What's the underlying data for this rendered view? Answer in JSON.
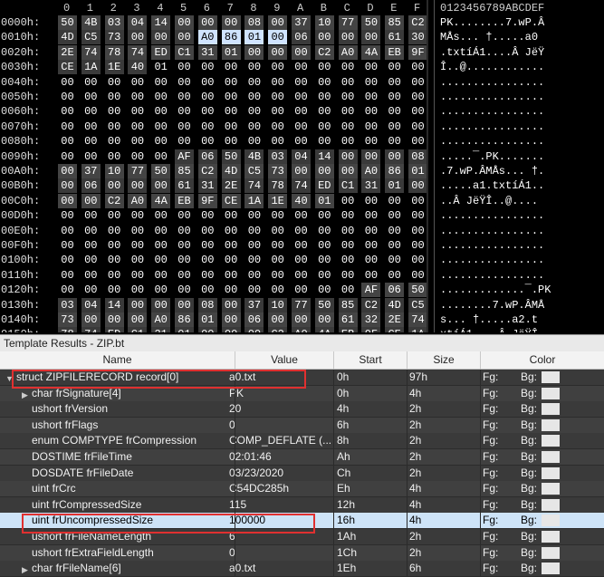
{
  "hex_header": {
    "columns": [
      "0",
      "1",
      "2",
      "3",
      "4",
      "5",
      "6",
      "7",
      "8",
      "9",
      "A",
      "B",
      "C",
      "D",
      "E",
      "F"
    ],
    "ascii_header": "0123456789ABCDEF"
  },
  "hex_rows": [
    {
      "offset": "0000h:",
      "bytes": [
        "50",
        "4B",
        "03",
        "04",
        "14",
        "00",
        "00",
        "00",
        "08",
        "00",
        "37",
        "10",
        "77",
        "50",
        "85",
        "C2"
      ],
      "ascii": "PK........7.wP.Â"
    },
    {
      "offset": "0010h:",
      "bytes": [
        "4D",
        "C5",
        "73",
        "00",
        "00",
        "00",
        "A0",
        "86",
        "01",
        "00",
        "06",
        "00",
        "00",
        "00",
        "61",
        "30"
      ],
      "ascii": "MÅs... †.....a0"
    },
    {
      "offset": "0020h:",
      "bytes": [
        "2E",
        "74",
        "78",
        "74",
        "ED",
        "C1",
        "31",
        "01",
        "00",
        "00",
        "00",
        "C2",
        "A0",
        "4A",
        "EB",
        "9F"
      ],
      "ascii": ".txtíÁ1....Â JëŸ"
    },
    {
      "offset": "0030h:",
      "bytes": [
        "CE",
        "1A",
        "1E",
        "40",
        "01",
        "00",
        "00",
        "00",
        "00",
        "00",
        "00",
        "00",
        "00",
        "00",
        "00",
        "00"
      ],
      "ascii": "Î..@............"
    },
    {
      "offset": "0040h:",
      "bytes": [
        "00",
        "00",
        "00",
        "00",
        "00",
        "00",
        "00",
        "00",
        "00",
        "00",
        "00",
        "00",
        "00",
        "00",
        "00",
        "00"
      ],
      "ascii": "................"
    },
    {
      "offset": "0050h:",
      "bytes": [
        "00",
        "00",
        "00",
        "00",
        "00",
        "00",
        "00",
        "00",
        "00",
        "00",
        "00",
        "00",
        "00",
        "00",
        "00",
        "00"
      ],
      "ascii": "................"
    },
    {
      "offset": "0060h:",
      "bytes": [
        "00",
        "00",
        "00",
        "00",
        "00",
        "00",
        "00",
        "00",
        "00",
        "00",
        "00",
        "00",
        "00",
        "00",
        "00",
        "00"
      ],
      "ascii": "................"
    },
    {
      "offset": "0070h:",
      "bytes": [
        "00",
        "00",
        "00",
        "00",
        "00",
        "00",
        "00",
        "00",
        "00",
        "00",
        "00",
        "00",
        "00",
        "00",
        "00",
        "00"
      ],
      "ascii": "................"
    },
    {
      "offset": "0080h:",
      "bytes": [
        "00",
        "00",
        "00",
        "00",
        "00",
        "00",
        "00",
        "00",
        "00",
        "00",
        "00",
        "00",
        "00",
        "00",
        "00",
        "00"
      ],
      "ascii": "................"
    },
    {
      "offset": "0090h:",
      "bytes": [
        "00",
        "00",
        "00",
        "00",
        "00",
        "AF",
        "06",
        "50",
        "4B",
        "03",
        "04",
        "14",
        "00",
        "00",
        "00",
        "08"
      ],
      "ascii": ".....¯.PK......."
    },
    {
      "offset": "00A0h:",
      "bytes": [
        "00",
        "37",
        "10",
        "77",
        "50",
        "85",
        "C2",
        "4D",
        "C5",
        "73",
        "00",
        "00",
        "00",
        "A0",
        "86",
        "01"
      ],
      "ascii": ".7.wP.ÂMÅs... †."
    },
    {
      "offset": "00B0h:",
      "bytes": [
        "00",
        "06",
        "00",
        "00",
        "00",
        "61",
        "31",
        "2E",
        "74",
        "78",
        "74",
        "ED",
        "C1",
        "31",
        "01",
        "00"
      ],
      "ascii": ".....a1.txtíÁ1.."
    },
    {
      "offset": "00C0h:",
      "bytes": [
        "00",
        "00",
        "C2",
        "A0",
        "4A",
        "EB",
        "9F",
        "CE",
        "1A",
        "1E",
        "40",
        "01",
        "00",
        "00",
        "00",
        "00"
      ],
      "ascii": "..Â JëŸÎ..@...."
    },
    {
      "offset": "00D0h:",
      "bytes": [
        "00",
        "00",
        "00",
        "00",
        "00",
        "00",
        "00",
        "00",
        "00",
        "00",
        "00",
        "00",
        "00",
        "00",
        "00",
        "00"
      ],
      "ascii": "................"
    },
    {
      "offset": "00E0h:",
      "bytes": [
        "00",
        "00",
        "00",
        "00",
        "00",
        "00",
        "00",
        "00",
        "00",
        "00",
        "00",
        "00",
        "00",
        "00",
        "00",
        "00"
      ],
      "ascii": "................"
    },
    {
      "offset": "00F0h:",
      "bytes": [
        "00",
        "00",
        "00",
        "00",
        "00",
        "00",
        "00",
        "00",
        "00",
        "00",
        "00",
        "00",
        "00",
        "00",
        "00",
        "00"
      ],
      "ascii": "................"
    },
    {
      "offset": "0100h:",
      "bytes": [
        "00",
        "00",
        "00",
        "00",
        "00",
        "00",
        "00",
        "00",
        "00",
        "00",
        "00",
        "00",
        "00",
        "00",
        "00",
        "00"
      ],
      "ascii": "................"
    },
    {
      "offset": "0110h:",
      "bytes": [
        "00",
        "00",
        "00",
        "00",
        "00",
        "00",
        "00",
        "00",
        "00",
        "00",
        "00",
        "00",
        "00",
        "00",
        "00",
        "00"
      ],
      "ascii": "................"
    },
    {
      "offset": "0120h:",
      "bytes": [
        "00",
        "00",
        "00",
        "00",
        "00",
        "00",
        "00",
        "00",
        "00",
        "00",
        "00",
        "00",
        "00",
        "AF",
        "06",
        "50",
        "4B"
      ],
      "ascii": ".............¯.PK"
    },
    {
      "offset": "0130h:",
      "bytes": [
        "03",
        "04",
        "14",
        "00",
        "00",
        "00",
        "08",
        "00",
        "37",
        "10",
        "77",
        "50",
        "85",
        "C2",
        "4D",
        "C5"
      ],
      "ascii": "........7.wP.ÂMÅ"
    },
    {
      "offset": "0140h:",
      "bytes": [
        "73",
        "00",
        "00",
        "00",
        "A0",
        "86",
        "01",
        "00",
        "06",
        "00",
        "00",
        "00",
        "61",
        "32",
        "2E",
        "74"
      ],
      "ascii": "s... †.....a2.t"
    },
    {
      "offset": "0150h:",
      "bytes": [
        "78",
        "74",
        "ED",
        "C1",
        "31",
        "01",
        "00",
        "00",
        "00",
        "C2",
        "A0",
        "4A",
        "EB",
        "9F",
        "CE",
        "1A"
      ],
      "ascii": "xtíÁ1....Â JëŸÎ."
    }
  ],
  "template": {
    "title": "Template Results - ZIP.bt",
    "headers": {
      "name": "Name",
      "value": "Value",
      "start": "Start",
      "size": "Size",
      "color": "Color"
    },
    "rows": [
      {
        "name": "struct ZIPFILERECORD record[0]",
        "value": "a0.txt",
        "start": "0h",
        "size": "97h",
        "fg": "Fg:",
        "bg": "Bg:"
      },
      {
        "name": "char frSignature[4]",
        "value": "PK",
        "start": "0h",
        "size": "4h",
        "fg": "Fg:",
        "bg": "Bg:"
      },
      {
        "name": "ushort frVersion",
        "value": "20",
        "start": "4h",
        "size": "2h",
        "fg": "Fg:",
        "bg": "Bg:"
      },
      {
        "name": "ushort frFlags",
        "value": "0",
        "start": "6h",
        "size": "2h",
        "fg": "Fg:",
        "bg": "Bg:"
      },
      {
        "name": "enum COMPTYPE frCompression",
        "value": "COMP_DEFLATE (...",
        "start": "8h",
        "size": "2h",
        "fg": "Fg:",
        "bg": "Bg:"
      },
      {
        "name": "DOSTIME frFileTime",
        "value": "02:01:46",
        "start": "Ah",
        "size": "2h",
        "fg": "Fg:",
        "bg": "Bg:"
      },
      {
        "name": "DOSDATE frFileDate",
        "value": "03/23/2020",
        "start": "Ch",
        "size": "2h",
        "fg": "Fg:",
        "bg": "Bg:"
      },
      {
        "name": "uint frCrc",
        "value": "C54DC285h",
        "start": "Eh",
        "size": "4h",
        "fg": "Fg:",
        "bg": "Bg:"
      },
      {
        "name": "uint frCompressedSize",
        "value": "115",
        "start": "12h",
        "size": "4h",
        "fg": "Fg:",
        "bg": "Bg:"
      },
      {
        "name": "uint frUncompressedSize",
        "value": "100000",
        "start": "16h",
        "size": "4h",
        "fg": "Fg:",
        "bg": "Bg:"
      },
      {
        "name": "ushort frFileNameLength",
        "value": "6",
        "start": "1Ah",
        "size": "2h",
        "fg": "Fg:",
        "bg": "Bg:"
      },
      {
        "name": "ushort frExtraFieldLength",
        "value": "0",
        "start": "1Ch",
        "size": "2h",
        "fg": "Fg:",
        "bg": "Bg:"
      },
      {
        "name": "char frFileName[6]",
        "value": "a0.txt",
        "start": "1Eh",
        "size": "6h",
        "fg": "Fg:",
        "bg": "Bg:"
      }
    ]
  },
  "colors": {
    "highlight": "#cfe3ff",
    "annotation": "#e03030"
  }
}
